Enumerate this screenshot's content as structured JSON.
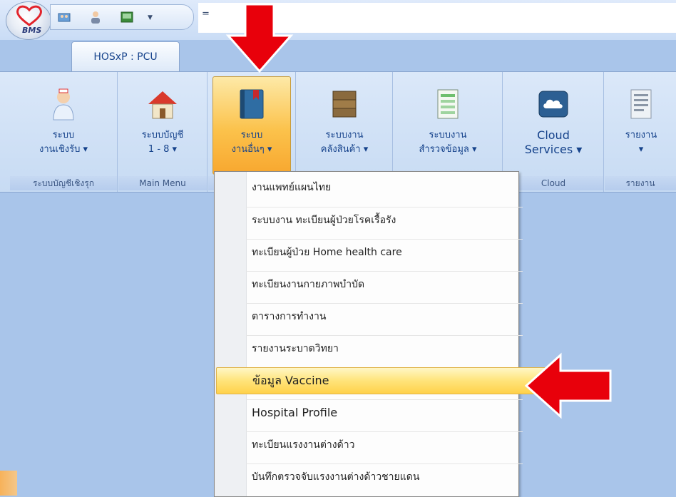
{
  "app": {
    "orb_text": "BMS",
    "tab_label": "HOSxP : PCU",
    "qat_more": "="
  },
  "ribbon": {
    "groups": [
      {
        "label": "ระบบบัญชีเชิงรุก",
        "buttons": [
          {
            "line1": "ระบบ",
            "line2": "งานเชิงรับ ▾",
            "icon": "nurse-icon"
          }
        ]
      },
      {
        "label": "Main Menu",
        "buttons": [
          {
            "line1": "ระบบบัญชี",
            "line2": "1 - 8 ▾",
            "icon": "house-icon"
          }
        ]
      },
      {
        "label": "",
        "buttons": [
          {
            "line1": "ระบบ",
            "line2": "งานอื่นๆ ▾",
            "icon": "book-icon",
            "active": true
          }
        ]
      },
      {
        "label": "",
        "buttons": [
          {
            "line1": "ระบบงาน",
            "line2": "คลังสินค้า ▾",
            "icon": "boxes-icon"
          }
        ]
      },
      {
        "label": "",
        "buttons": [
          {
            "line1": "ระบบงาน",
            "line2": "สำรวจข้อมูล ▾",
            "icon": "spreadsheet-icon"
          }
        ]
      },
      {
        "label": "Cloud",
        "buttons": [
          {
            "line1": "Cloud",
            "line2": "Services ▾",
            "icon": "cloud-icon"
          }
        ]
      },
      {
        "label": "รายงาน",
        "buttons": [
          {
            "line1": "รายงาน",
            "line2": "▾",
            "icon": "report-icon"
          }
        ]
      }
    ]
  },
  "menu": {
    "items": [
      {
        "label": "งานแพทย์แผนไทย"
      },
      {
        "label": "ระบบงาน ทะเบียนผู้ป่วยโรคเรื้อรัง"
      },
      {
        "label": "ทะเบียนผู้ป่วย Home health care"
      },
      {
        "label": "ทะเบียนงานกายภาพบำบัด"
      },
      {
        "label": "ตารางการทำงาน"
      },
      {
        "label": "รายงานระบาดวิทยา"
      },
      {
        "label": "ข้อมูล Vaccine",
        "highlighted": true
      },
      {
        "label": "Hospital Profile"
      },
      {
        "label": "ทะเบียนแรงงานต่างด้าว"
      },
      {
        "label": "บันทึกตรวจจับแรงงานต่างด้าวชายแดน"
      }
    ]
  },
  "colors": {
    "accent": "#15428b",
    "highlight": "#ffd24a",
    "arrow": "#e8000b"
  }
}
